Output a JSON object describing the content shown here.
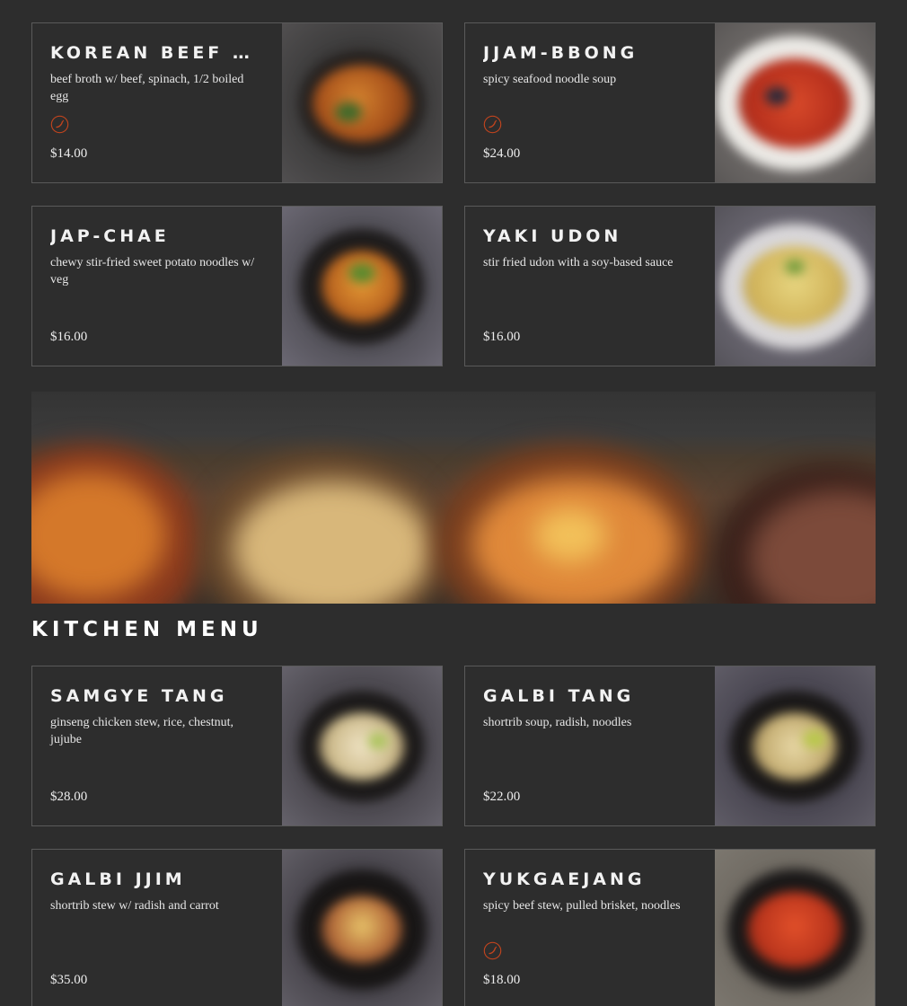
{
  "kitchen_menu": {
    "title": "KITCHEN MENU"
  },
  "noodle_items": [
    {
      "name": "KOREAN BEEF RAMEN",
      "description": "beef broth w/ beef, spinach, 1/2 boiled egg",
      "price": "$14.00",
      "spicy": true,
      "photo_icon": "noodle-bowl-photo"
    },
    {
      "name": "JJAM-BBONG",
      "description": "spicy seafood noodle soup",
      "price": "$24.00",
      "spicy": true,
      "photo_icon": "seafood-soup-photo"
    },
    {
      "name": "JAP-CHAE",
      "description": "chewy stir-fried sweet potato noodles w/ veg",
      "price": "$16.00",
      "spicy": false,
      "photo_icon": "japchae-photo"
    },
    {
      "name": "YAKI UDON",
      "description": "stir fried udon with a soy-based sauce",
      "price": "$16.00",
      "spicy": false,
      "photo_icon": "udon-photo"
    }
  ],
  "kitchen_items": [
    {
      "name": "SAMGYE TANG",
      "description": "ginseng chicken stew, rice, chestnut, jujube",
      "price": "$28.00",
      "spicy": false,
      "photo_icon": "samgyetang-photo"
    },
    {
      "name": "GALBI TANG",
      "description": "shortrib soup, radish, noodles",
      "price": "$22.00",
      "spicy": false,
      "photo_icon": "galbitang-photo"
    },
    {
      "name": "GALBI JJIM",
      "description": "shortrib stew w/ radish and carrot",
      "price": "$35.00",
      "spicy": false,
      "photo_icon": "galbijjim-photo"
    },
    {
      "name": "YUKGAEJANG",
      "description": "spicy beef stew, pulled brisket, noodles",
      "price": "$18.00",
      "spicy": true,
      "photo_icon": "yukgaejang-photo"
    }
  ],
  "colors": {
    "background": "#2d2d2d",
    "card_border": "#5a5a5a",
    "spicy_icon": "#c1441e",
    "title_text": "#f2f2f2"
  }
}
